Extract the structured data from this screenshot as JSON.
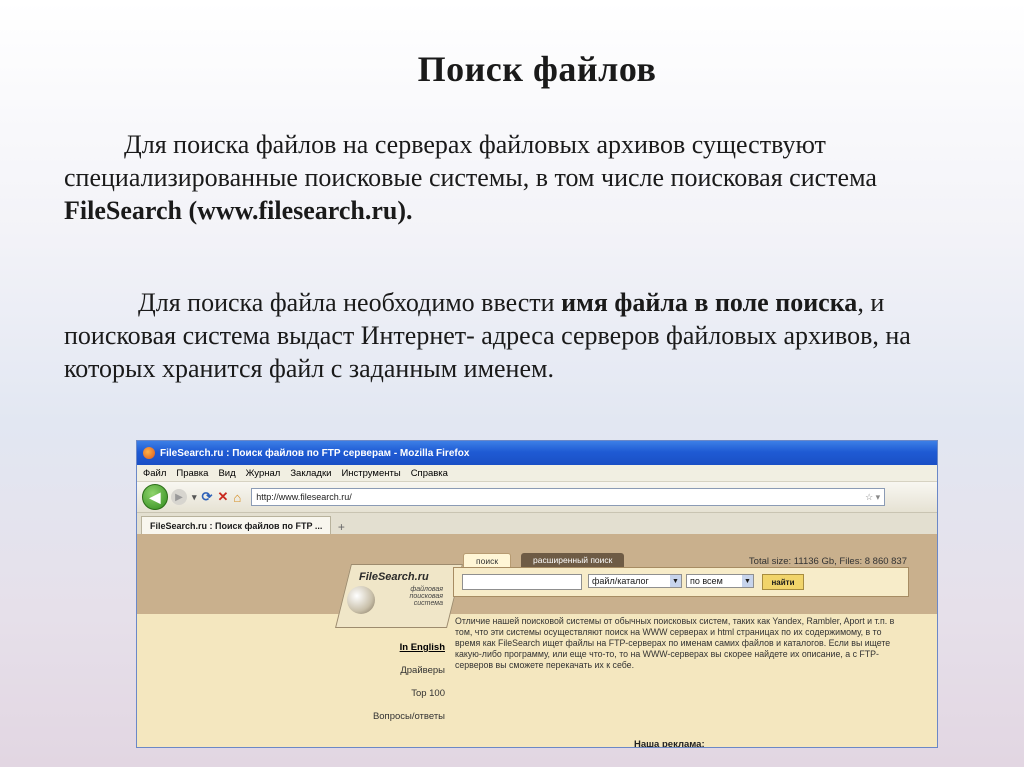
{
  "slide": {
    "title": "Поиск файлов",
    "p1_a": "Для поиска файлов на серверах файловых архивов существуют специализированные поисковые системы, в том числе поисковая система ",
    "p1_b": "FileSearch (www.filesearch.ru).",
    "p2_a": "Для поиска файла необходимо ввести ",
    "p2_b": "имя файла в поле поиска",
    "p2_c": ", и поисковая система выдаст Интернет- адреса серверов файловых архивов, на которых хранится файл с заданным именем."
  },
  "browser": {
    "window_title": "FileSearch.ru : Поиск файлов по FTP серверам - Mozilla Firefox",
    "menu": [
      "Файл",
      "Правка",
      "Вид",
      "Журнал",
      "Закладки",
      "Инструменты",
      "Справка"
    ],
    "url": "http://www.filesearch.ru/",
    "tab_label": "FileSearch.ru : Поиск файлов по FTP ...",
    "nav_icons": [
      "back-icon",
      "forward-icon",
      "reload-icon",
      "stop-icon",
      "home-icon",
      "star-icon"
    ]
  },
  "site": {
    "stats": "Total size: 11136 Gb, Files: 8 860 837",
    "logo": "FileSearch.ru",
    "logo_sub": "файловая поисковая система",
    "tab_search": "поиск",
    "tab_advanced": "расширенный поиск",
    "select_type": "файл/каталог",
    "select_scope": "по всем",
    "go_button": "найти",
    "description": "Отличие нашей поисковой системы от обычных поисковых систем, таких как Yandex, Rambler, Aport и т.п. в том, что эти системы осуществляют поиск на WWW серверах и html страницах по их содержимому, в то время как FileSearch ищет файлы на FTP-серверах по именам самих файлов и каталогов. Если вы ищете какую-либо программу, или еще что-то, то на WWW-серверах вы скорее найдете их описание, а с FTP-серверов вы сможете перекачать их к себе.",
    "nav": [
      "In English",
      "Драйверы",
      "Top 100",
      "Вопросы/ответы"
    ],
    "ad_title": "Наша реклама:"
  }
}
